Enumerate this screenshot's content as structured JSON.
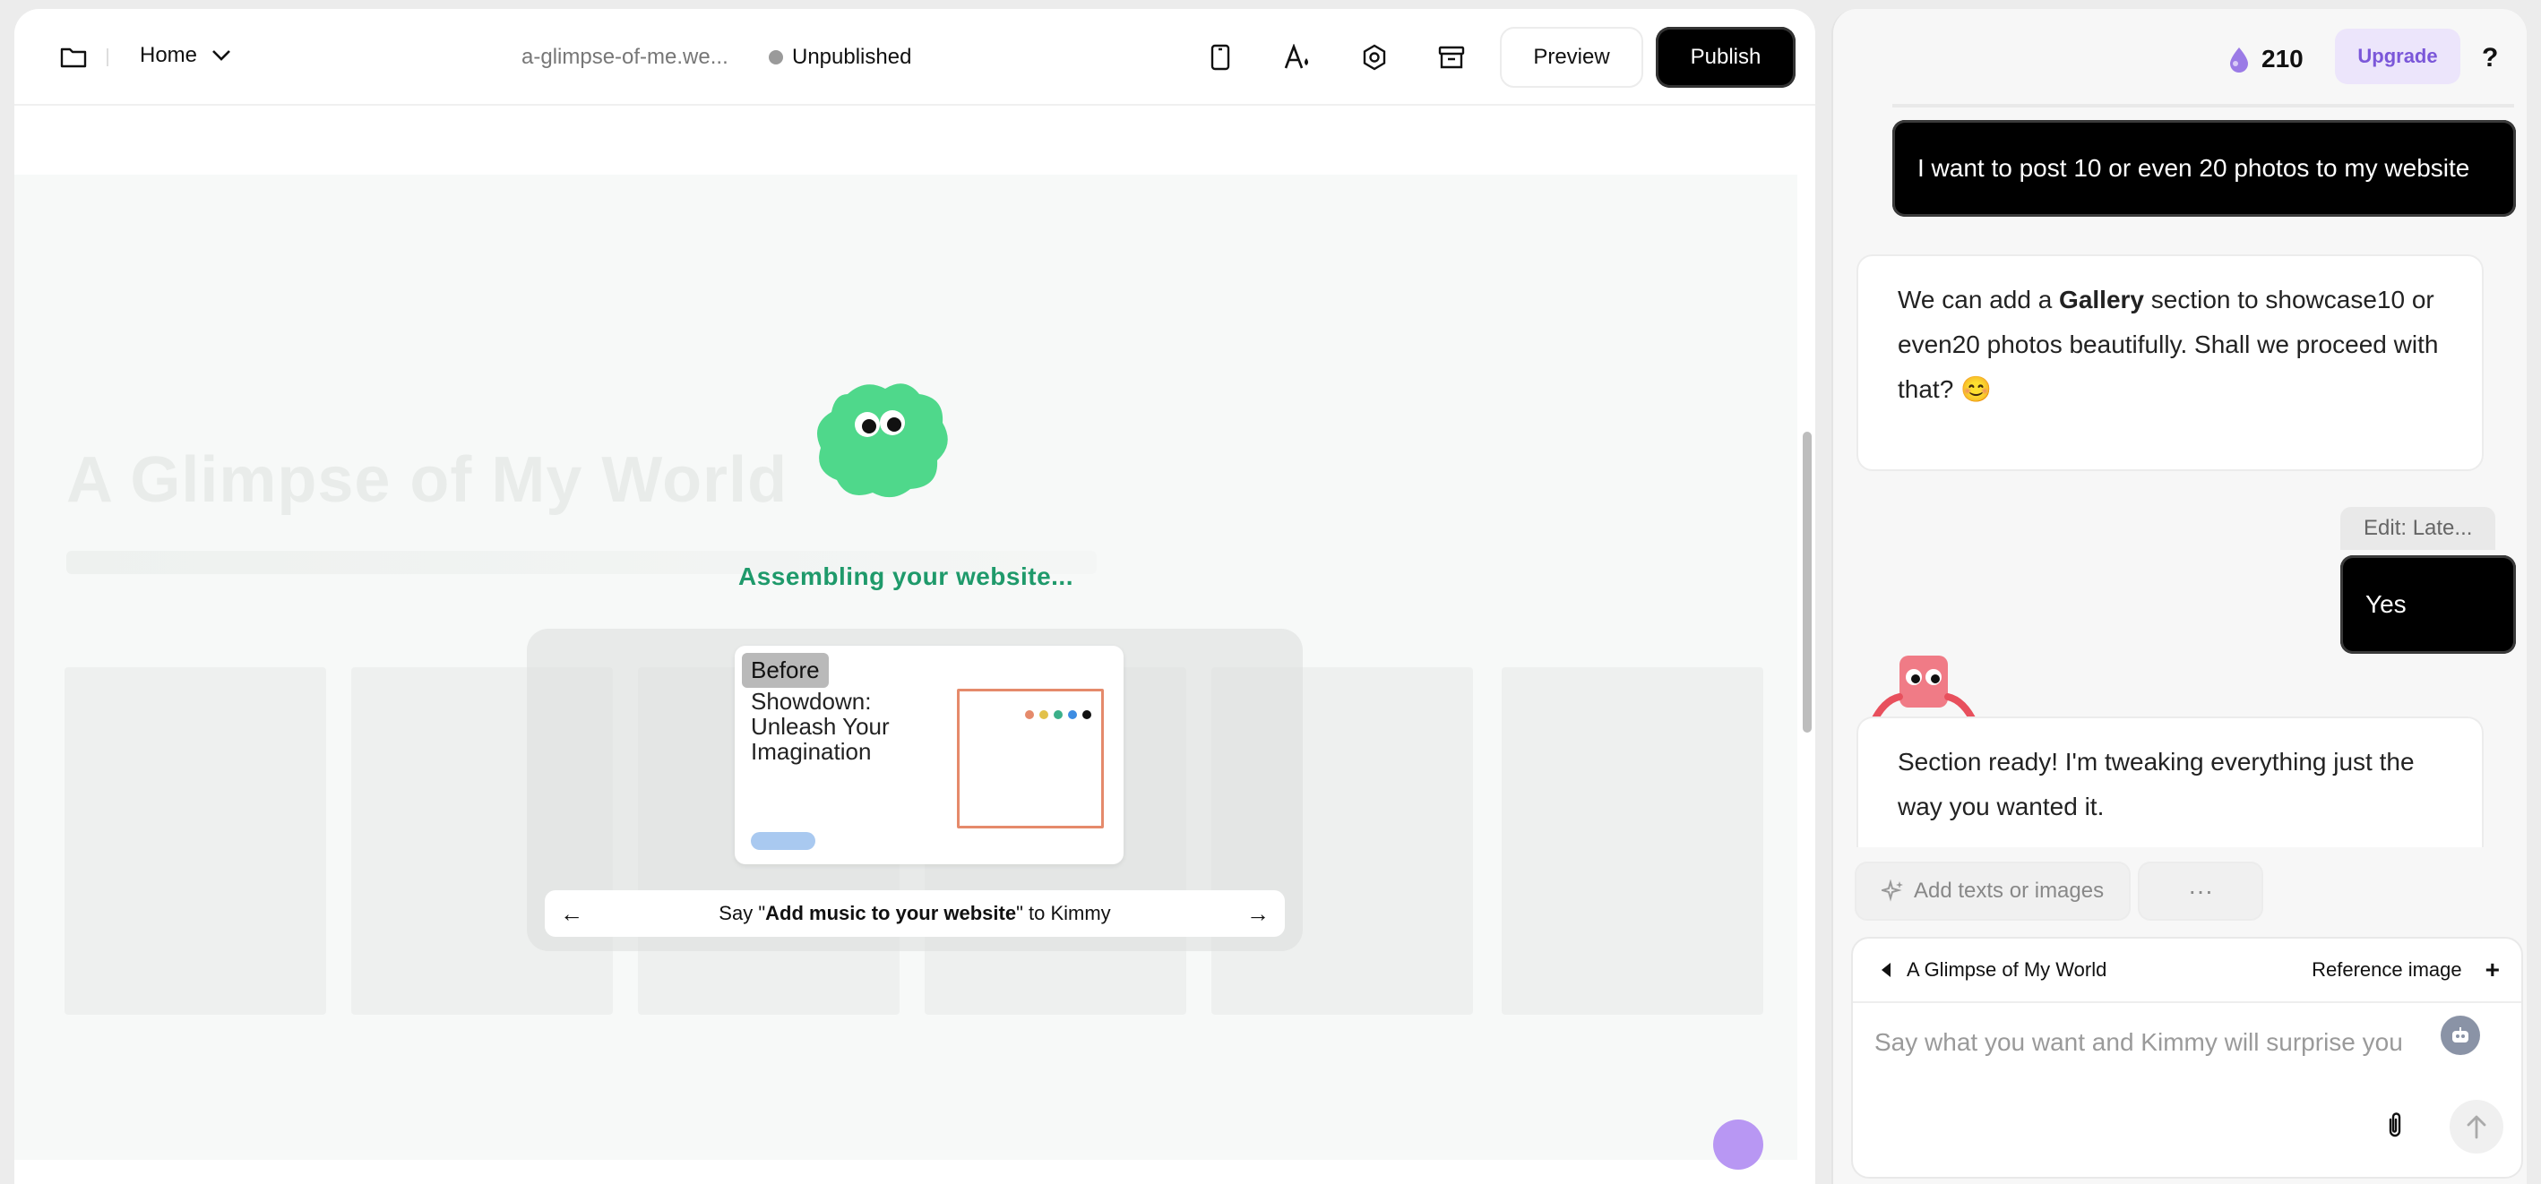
{
  "editor": {
    "page_selector": "Home",
    "site_name": "a-glimpse-of-me.we...",
    "status": "Unpublished",
    "preview_label": "Preview",
    "publish_label": "Publish",
    "toolbar_icons": [
      "folder-icon",
      "mobile-view-icon",
      "theme-style-icon",
      "settings-icon",
      "archive-icon"
    ]
  },
  "canvas": {
    "ghost_title": "A Glimpse of My World",
    "assembling_text": "Assembling your website...",
    "tip": {
      "badge": "Before",
      "mock_heading": "Showdown: Unleash Your Imagination",
      "prefix": "Say \"",
      "bold": "Add music to your website",
      "suffix": "\" to Kimmy"
    }
  },
  "chat": {
    "credits": "210",
    "upgrade_label": "Upgrade",
    "help_label": "?",
    "messages": [
      {
        "role": "user",
        "text": "I want to post 10 or even 20 photos to my website"
      },
      {
        "role": "bot",
        "text_before": "We can add a ",
        "bold": "Gallery",
        "text_after": " section to showcase10 or even20 photos beautifully. Shall we proceed with that? 😊"
      },
      {
        "role": "user",
        "chip": "Edit: Late...",
        "text": "Yes"
      },
      {
        "role": "bot",
        "text": "Section ready! I'm tweaking everything just the way you wanted it."
      }
    ],
    "quick_actions": {
      "add_label": "Add texts or images",
      "more_label": "···"
    },
    "composer": {
      "context_title": "A Glimpse of My World",
      "reference_label": "Reference image",
      "add_label": "+",
      "placeholder": "Say what you want and Kimmy will surprise you"
    }
  }
}
